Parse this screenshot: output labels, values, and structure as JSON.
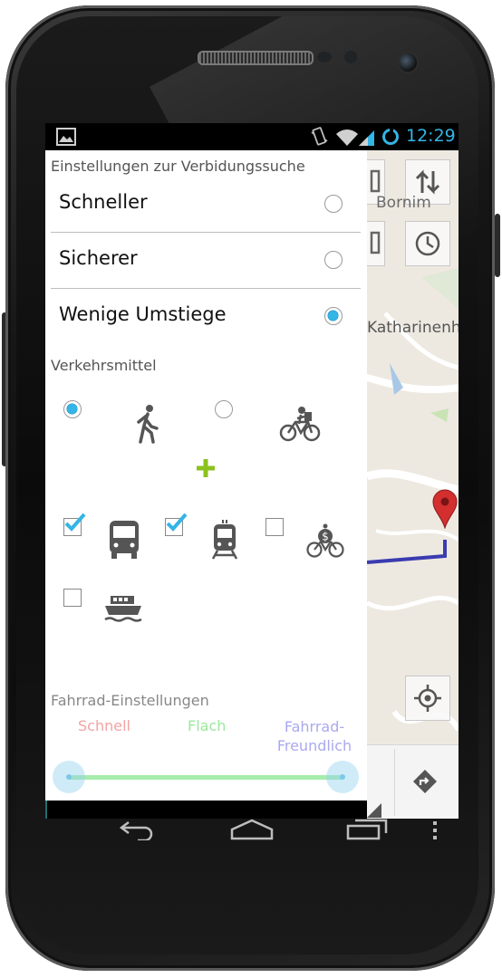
{
  "status_bar": {
    "time": "12:29",
    "icons": [
      "gallery-notification-icon",
      "vibrate-icon",
      "wifi-icon",
      "signal-icon",
      "sync-icon"
    ],
    "accent_color": "#33b5e5"
  },
  "drawer": {
    "routing_header": "Einstellungen zur Verbidungssuche",
    "routing_options": [
      {
        "label": "Schneller",
        "selected": false
      },
      {
        "label": "Sicherer",
        "selected": false
      },
      {
        "label": "Wenige Umstiege",
        "selected": true
      }
    ],
    "transport_header": "Verkehrsmittel",
    "primary_modes": [
      {
        "icon": "walk-icon",
        "selected": true
      },
      {
        "icon": "bicycle-icon",
        "selected": false
      }
    ],
    "plus_icon": "plus-icon",
    "public_modes": [
      {
        "icon": "bus-icon",
        "checked": true
      },
      {
        "icon": "tram-icon",
        "checked": true
      },
      {
        "icon": "bike-rental-icon",
        "checked": false
      },
      {
        "icon": "ferry-icon",
        "checked": false
      }
    ],
    "bike_header": "Fahrrad-Einstellungen",
    "bike_slider": {
      "labels": [
        "Schnell",
        "Flach",
        "Fahrrad-Freundlich"
      ],
      "label_colors": [
        "#f4a3a3",
        "#9be89b",
        "#a9a9ee"
      ],
      "range_start": 0,
      "range_end": 1
    }
  },
  "map": {
    "labels": [
      "Bornim",
      "Katharinenh"
    ],
    "buttons": [
      "layers-icon",
      "swap-icon",
      "layers-icon",
      "clock-icon",
      "my-location-icon",
      "directions-icon"
    ]
  },
  "nav_bar": {
    "buttons": [
      "back-icon",
      "home-icon",
      "recent-apps-icon",
      "menu-icon"
    ]
  }
}
